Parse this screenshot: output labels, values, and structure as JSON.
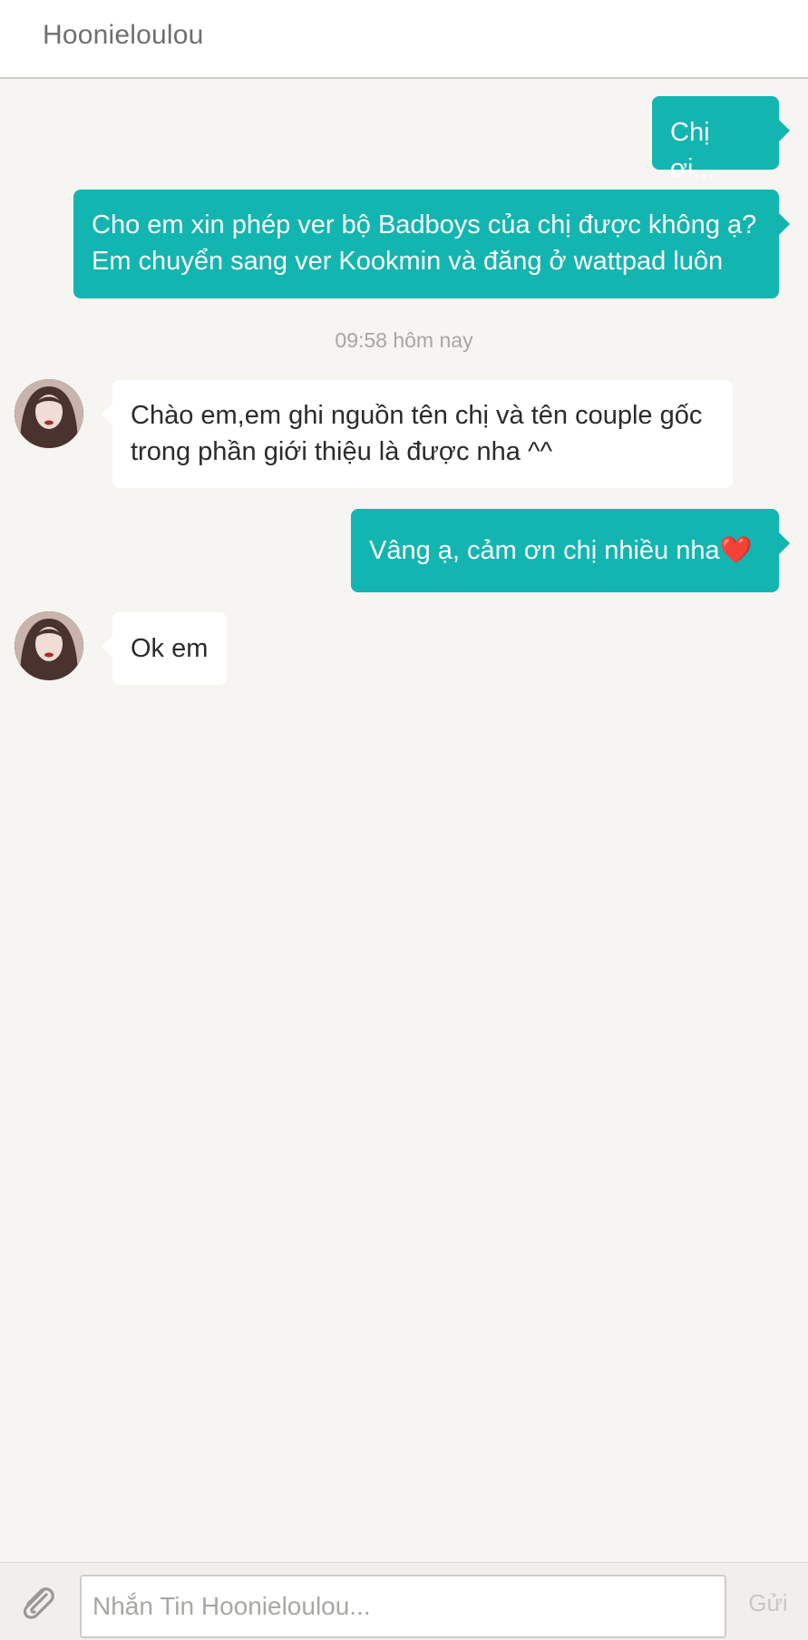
{
  "header": {
    "title": "Hoonieloulou"
  },
  "messages": [
    {
      "direction": "out",
      "text": "Chị ơi..."
    },
    {
      "direction": "out",
      "text": "Cho em xin phép ver bộ Badboys của chị được không ạ?\nEm chuyển sang ver Kookmin và đăng ở wattpad luôn"
    },
    {
      "direction": "in",
      "text": "Chào em,em ghi nguồn tên chị và tên couple gốc\ntrong phần giới thiệu là được nha ^^"
    },
    {
      "direction": "out",
      "text": "Vâng ạ, cảm ơn chị nhiều nha❤️"
    },
    {
      "direction": "in",
      "text": "Ok em"
    }
  ],
  "timestamp": "09:58 hôm nay",
  "composer": {
    "placeholder": "Nhắn Tin Hoonieloulou...",
    "send_label": "Gửi",
    "attach_icon": "paperclip-icon"
  },
  "colors": {
    "outgoing_bubble": "#12b5b0",
    "incoming_bubble": "#ffffff",
    "background": "#f6f5f1"
  }
}
